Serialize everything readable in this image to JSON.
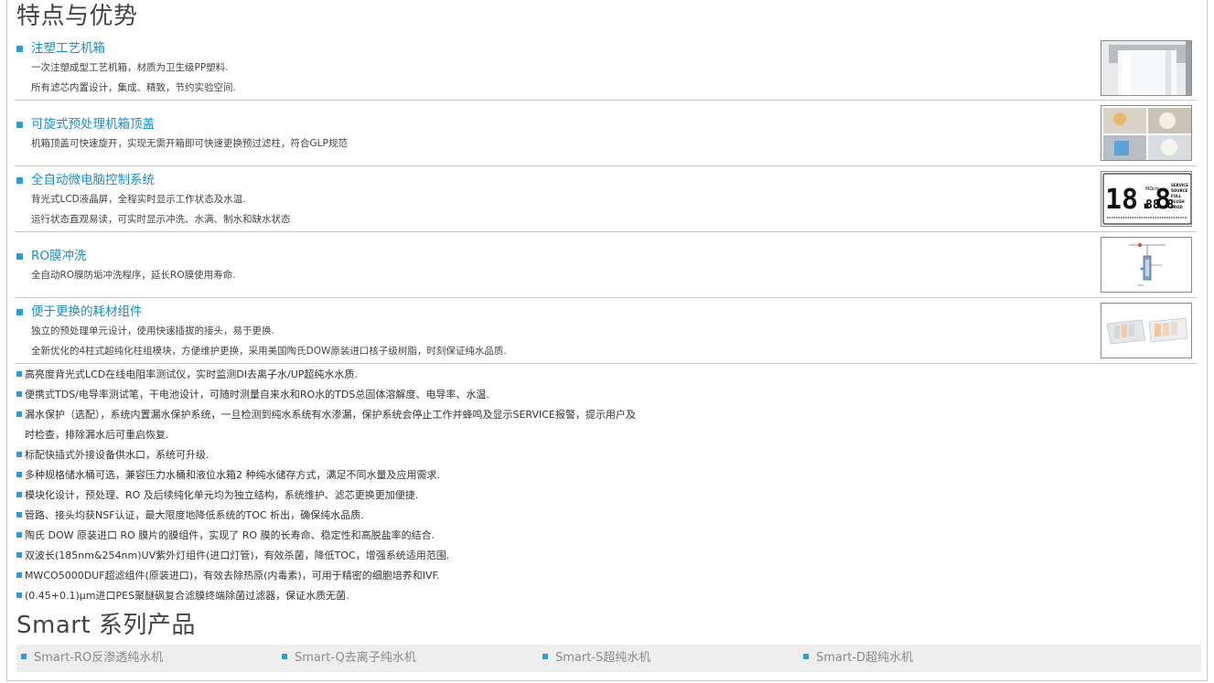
{
  "section_titles": {
    "features": "特点与优势",
    "series": "Smart 系列产品"
  },
  "features": [
    {
      "title": "注塑工艺机箱",
      "lines": [
        "一次注塑成型工艺机箱，材质为卫生级PP塑料.",
        "所有滤芯内置设计，集成、精致，节约实验空间."
      ],
      "image_icon": "cabinet-photo-icon"
    },
    {
      "title": "可旋式预处理机箱顶盖",
      "lines": [
        "机箱顶盖可快速旋开，实现无需开箱即可快速更换预过滤柱，符合GLP规范"
      ],
      "image_icon": "cover-photos-icon"
    },
    {
      "title": "全自动微电脑控制系统",
      "lines": [
        "背光式LCD液晶屏，全程实时显示工作状态及水温.",
        "运行状态直观易读，可实时显示冲洗、水满、制水和缺水状态"
      ],
      "image_icon": "lcd-display-icon",
      "lcd": {
        "big": "18.8",
        "unit": "MΩcm",
        "small": "88.8",
        "small_unit": "°C",
        "status": [
          "SERVICE",
          "SOURCE",
          "FULL",
          "FLUSH",
          "PROD"
        ]
      }
    },
    {
      "title": "RO膜冲洗",
      "lines": [
        "全自动RO膜防垢冲洗程序，延长RO膜使用寿命."
      ],
      "image_icon": "ro-flush-diagram-icon"
    },
    {
      "title": "便于更换的耗材组件",
      "lines": [
        "独立的预处理单元设计，使用快速插拔的接头，易于更换.",
        "全新优化的4柱式超纯化柱组模块，方便维护更换，采用美国陶氏DOW原装进口核子级树脂，时刻保证纯水品质."
      ],
      "image_icon": "consumables-photo-icon"
    }
  ],
  "bullet_list": [
    {
      "text": "高亮度背光式LCD在线电阻率测试仪，实时监测DI去离子水/UP超纯水水质."
    },
    {
      "text": "便携式TDS/电导率测试笔，干电池设计，可随时测量自来水和RO水的TDS总固体溶解度、电导率、水温."
    },
    {
      "text": "漏水保护（选配），系统内置漏水保护系统，一旦检测到纯水系统有水渗漏，保护系统会停止工作并蜂鸣及显示SERVICE报警，提示用户及",
      "cont": "时检查，排除漏水后可重启恢复."
    },
    {
      "text": "标配快插式外接设备供水口，系统可升级."
    },
    {
      "text": "多种规格储水桶可选，兼容压力水桶和液位水箱2 种纯水储存方式，满足不同水量及应用需求."
    },
    {
      "text": "模块化设计，预处理、RO 及后续纯化单元均为独立结构，系统维护、滤芯更换更加便捷."
    },
    {
      "text": "管路、接头均获NSF认证，最大限度地降低系统的TOC 析出，确保纯水品质."
    },
    {
      "text": "陶氏 DOW 原装进口 RO 膜片的膜组件，实现了 RO 膜的长寿命、稳定性和高脱盐率的结合."
    },
    {
      "text": "双波长(185nm&254nm)UV紫外灯组件(进口灯管)，有效杀菌，降低TOC，增强系统适用范围."
    },
    {
      "text": "MWCO5000DUF超滤组件(原装进口)，有效去除热原(内毒素)，可用于精密的细胞培养和IVF."
    },
    {
      "text": "(0.45+0.1)μm进口PES聚醚砜复合滤膜终端除菌过滤器，保证水质无菌."
    }
  ],
  "series_products": [
    {
      "label": "Smart-RO反渗透纯水机"
    },
    {
      "label": "Smart-Q去离子纯水机"
    },
    {
      "label": "Smart-S超纯水机"
    },
    {
      "label": "Smart-D超纯水机"
    }
  ],
  "colors": {
    "accent": "#2a9fd6",
    "feature_title": "#1a8fcd",
    "series_bar": "#eeeeee"
  }
}
